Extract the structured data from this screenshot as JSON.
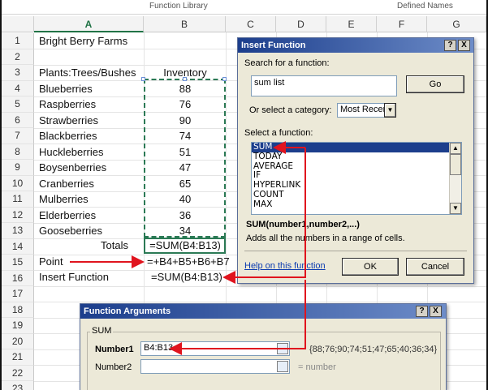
{
  "ribbon": {
    "group1": "Function Library",
    "group2": "Defined Names"
  },
  "columns": [
    "A",
    "B",
    "C",
    "D",
    "E",
    "F",
    "G"
  ],
  "rows": [
    "1",
    "2",
    "3",
    "4",
    "5",
    "6",
    "7",
    "8",
    "9",
    "10",
    "11",
    "12",
    "13",
    "14",
    "15",
    "16",
    "17",
    "18",
    "19",
    "20",
    "21",
    "22",
    "23"
  ],
  "sheet": {
    "a1": "Bright Berry Farms",
    "a3": "Plants:Trees/Bushes",
    "b3": "Inventory",
    "items": [
      {
        "name": "Blueberries",
        "qty": "88"
      },
      {
        "name": "Raspberries",
        "qty": "76"
      },
      {
        "name": "Strawberries",
        "qty": "90"
      },
      {
        "name": "Blackberries",
        "qty": "74"
      },
      {
        "name": "Huckleberries",
        "qty": "51"
      },
      {
        "name": "Boysenberries",
        "qty": "47"
      },
      {
        "name": "Cranberries",
        "qty": "65"
      },
      {
        "name": "Mulberries",
        "qty": "40"
      },
      {
        "name": "Elderberries",
        "qty": "36"
      },
      {
        "name": "Gooseberries",
        "qty": "34"
      }
    ],
    "a14": "Totals",
    "b14": "=SUM(B4:B13)",
    "a15": "Point",
    "b15": "=+B4+B5+B6+B7",
    "a16": "Insert Function",
    "b16": "=SUM(B4:B13)"
  },
  "insert_function": {
    "title": "Insert Function",
    "help_btn": "?",
    "close_btn": "X",
    "search_label": "Search for a function:",
    "search_value": "sum list",
    "go_btn": "Go",
    "category_label": "Or select a category:",
    "category_value": "Most Recer",
    "select_label": "Select a function:",
    "functions": [
      "SUM",
      "TODAY",
      "AVERAGE",
      "IF",
      "HYPERLINK",
      "COUNT",
      "MAX"
    ],
    "selected_index": 0,
    "signature": "SUM(number1,number2,...)",
    "description": "Adds all the numbers in a range of cells.",
    "help_link": "Help on this function",
    "ok_btn": "OK",
    "cancel_btn": "Cancel"
  },
  "function_arguments": {
    "title": "Function Arguments",
    "help_btn": "?",
    "close_btn": "X",
    "group_label": "SUM",
    "number1_label": "Number1",
    "number1_value": "B4:B13",
    "number1_result": "{88;76;90;74;51;47;65;40;36;34}",
    "number2_label": "Number2",
    "number2_value": "",
    "number2_result": "= number"
  },
  "colors": {
    "arrow": "#e0141e",
    "selection": "#2b7a55",
    "title_bar": "#1c3e8c"
  }
}
